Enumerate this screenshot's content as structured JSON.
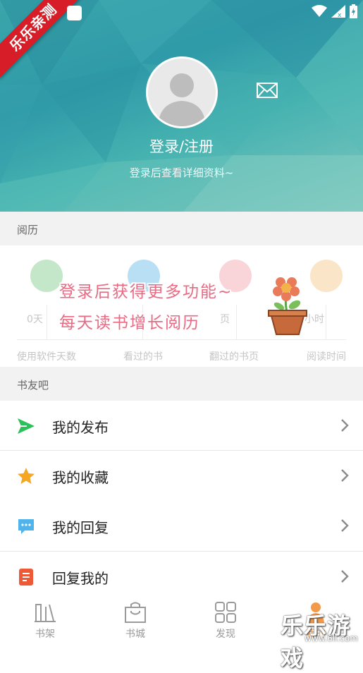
{
  "watermark_ribbon": "乐乐亲测",
  "profile": {
    "login_label": "登录/注册",
    "login_hint": "登录后查看详细资料~"
  },
  "reading_history": {
    "section_title": "阅历",
    "stats": [
      {
        "value": "0天",
        "label": "使用软件天数",
        "color": "#7cc98a"
      },
      {
        "value": "",
        "label": "看过的书",
        "color": "#63b8e8"
      },
      {
        "value": "页",
        "label": "翻过的书页",
        "color": "#f2a0a8"
      },
      {
        "value": "小时",
        "label": "阅读时间",
        "color": "#f7c688"
      }
    ],
    "promo_line1": "登录后获得更多功能~",
    "promo_line2": "每天读书增长阅历"
  },
  "book_friends": {
    "section_title": "书友吧",
    "items": [
      {
        "label": "我的发布",
        "icon": "send-icon",
        "color": "#2cc05a"
      },
      {
        "label": "我的收藏",
        "icon": "star-icon",
        "color": "#f5a623"
      },
      {
        "label": "我的回复",
        "icon": "chat-bubble-icon",
        "color": "#4fb3ec"
      },
      {
        "label": "回复我的",
        "icon": "document-icon",
        "color": "#ef5a36"
      }
    ]
  },
  "tabbar": {
    "tabs": [
      {
        "label": "书架",
        "icon": "bookshelf-icon"
      },
      {
        "label": "书城",
        "icon": "bookstore-bag-icon"
      },
      {
        "label": "发现",
        "icon": "discover-grid-icon"
      },
      {
        "label": "我的",
        "icon": "profile-icon",
        "active_color": "#f39a4a"
      }
    ]
  },
  "corner_watermark": {
    "text": "乐乐游戏",
    "url": "www.6ll.com"
  }
}
